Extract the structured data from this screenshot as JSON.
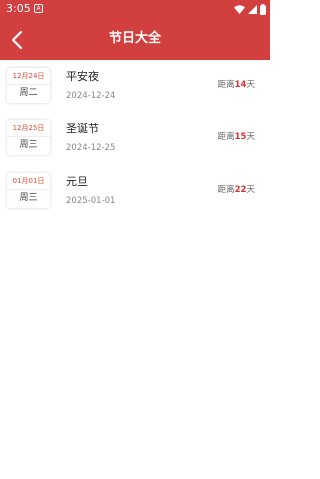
{
  "status_bar": {
    "time": "3:05",
    "notification_icon": "A"
  },
  "header": {
    "title": "节日大全",
    "back_icon": "chevron-left"
  },
  "holidays": [
    {
      "month_day": "12月24日",
      "weekday": "周二",
      "name": "平安夜",
      "date": "2024-12-24",
      "prefix": "距离",
      "days": "14",
      "suffix": "天"
    },
    {
      "month_day": "12月25日",
      "weekday": "周三",
      "name": "圣诞节",
      "date": "2024-12-25",
      "prefix": "距离",
      "days": "15",
      "suffix": "天"
    },
    {
      "month_day": "01月01日",
      "weekday": "周三",
      "name": "元旦",
      "date": "2025-01-01",
      "prefix": "距离",
      "days": "22",
      "suffix": "天"
    }
  ],
  "colors": {
    "header_bg": "#d23f3f",
    "accent": "#e0332f"
  }
}
